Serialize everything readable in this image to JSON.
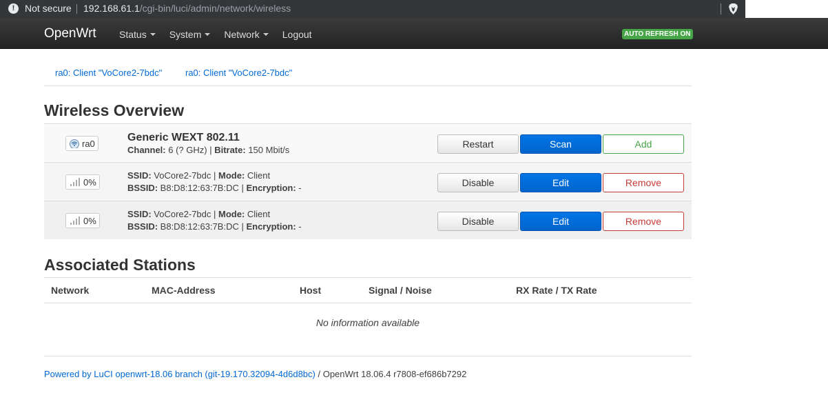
{
  "browser": {
    "security_label": "Not secure",
    "url_host": "192.168.61.1",
    "url_path": "/cgi-bin/luci/admin/network/wireless"
  },
  "navbar": {
    "brand": "OpenWrt",
    "menu": [
      "Status",
      "System",
      "Network",
      "Logout"
    ],
    "refresh_badge": "AUTO REFRESH ON"
  },
  "tabs": [
    "ra0: Client \"VoCore2-7bdc\"",
    "ra0: Client \"VoCore2-7bdc\""
  ],
  "wireless": {
    "heading": "Wireless Overview",
    "device": {
      "iface": "ra0",
      "title": "Generic WEXT 802.11",
      "channel_label": "Channel:",
      "channel_value": " 6 (? GHz) | ",
      "bitrate_label": "Bitrate:",
      "bitrate_value": " 150 Mbit/s",
      "buttons": [
        "Restart",
        "Scan",
        "Add"
      ]
    },
    "networks": [
      {
        "signal": "0%",
        "ssid_label": "SSID:",
        "ssid": " VoCore2-7bdc | ",
        "mode_label": "Mode:",
        "mode": " Client",
        "bssid_label": "BSSID:",
        "bssid": " B8:D8:12:63:7B:DC | ",
        "enc_label": "Encryption:",
        "enc": " -",
        "buttons": [
          "Disable",
          "Edit",
          "Remove"
        ]
      },
      {
        "signal": "0%",
        "ssid_label": "SSID:",
        "ssid": " VoCore2-7bdc | ",
        "mode_label": "Mode:",
        "mode": " Client",
        "bssid_label": "BSSID:",
        "bssid": " B8:D8:12:63:7B:DC | ",
        "enc_label": "Encryption:",
        "enc": " -",
        "buttons": [
          "Disable",
          "Edit",
          "Remove"
        ]
      }
    ]
  },
  "stations": {
    "heading": "Associated Stations",
    "columns": [
      "Network",
      "MAC-Address",
      "Host",
      "Signal / Noise",
      "RX Rate / TX Rate"
    ],
    "empty_text": "No information available"
  },
  "footer": {
    "link_text": "Powered by LuCI openwrt-18.06 branch (git-19.170.32094-4d6d8bc)",
    "rest": " / OpenWrt 18.06.4 r7808-ef686b7292"
  },
  "colors": {
    "primary": "#0064cd",
    "success": "#46a546",
    "danger": "#c43c35",
    "link": "#0069d6"
  }
}
